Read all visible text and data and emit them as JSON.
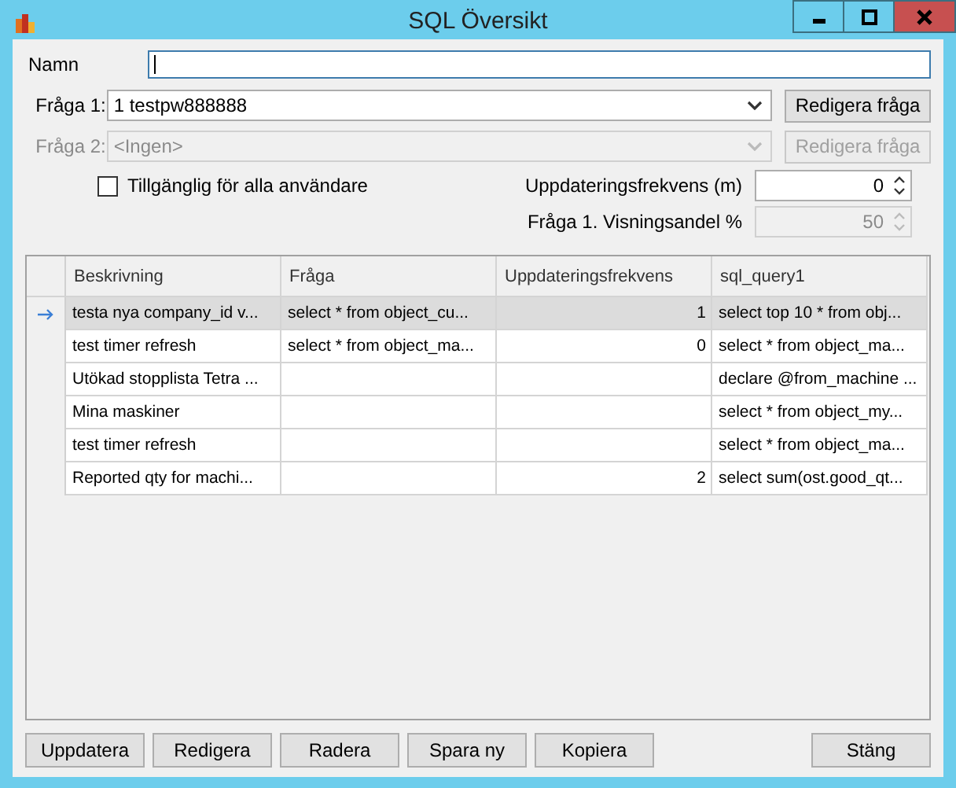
{
  "window": {
    "title": "SQL Översikt"
  },
  "name_field": {
    "label": "Namn"
  },
  "query_1": {
    "label": "Fråga 1:",
    "value": "1 testpw888888",
    "disabled": false,
    "button": "Redigera fråga"
  },
  "query_2": {
    "label": "Fråga 2:",
    "value": "<Ingen>",
    "disabled": true,
    "button": "Redigera fråga"
  },
  "available_for_all": {
    "label": "Tillgänglig för alla användare",
    "checked": false
  },
  "update_frequency": {
    "label": "Uppdateringsfrekvens (m)",
    "value": "0",
    "disabled": false
  },
  "display_share": {
    "label": "Fråga 1. Visningsandel %",
    "value": "50",
    "disabled": true
  },
  "table": {
    "columns": [
      "Beskrivning",
      "Fråga",
      "Uppdateringsfrekvens",
      "sql_query1"
    ],
    "rows": [
      {
        "cells": [
          "testa nya company_id v...",
          "select * from object_cu...",
          "1",
          "select top 10 * from obj..."
        ],
        "selected": true
      },
      {
        "cells": [
          "test timer refresh",
          "select * from object_ma...",
          "0",
          "select * from object_ma..."
        ],
        "selected": false
      },
      {
        "cells": [
          "Utökad stopplista Tetra ...",
          "",
          "",
          "declare @from_machine ..."
        ],
        "selected": false
      },
      {
        "cells": [
          "Mina maskiner",
          "",
          "",
          "select * from object_my..."
        ],
        "selected": false
      },
      {
        "cells": [
          "test timer refresh",
          "",
          "",
          "select * from object_ma..."
        ],
        "selected": false
      },
      {
        "cells": [
          "Reported qty for machi...",
          "",
          "2",
          "select sum(ost.good_qt..."
        ],
        "selected": false
      }
    ]
  },
  "buttons": [
    "Uppdatera",
    "Redigera",
    "Radera",
    "Spara ny",
    "Kopiera"
  ],
  "close_button": "Stäng"
}
